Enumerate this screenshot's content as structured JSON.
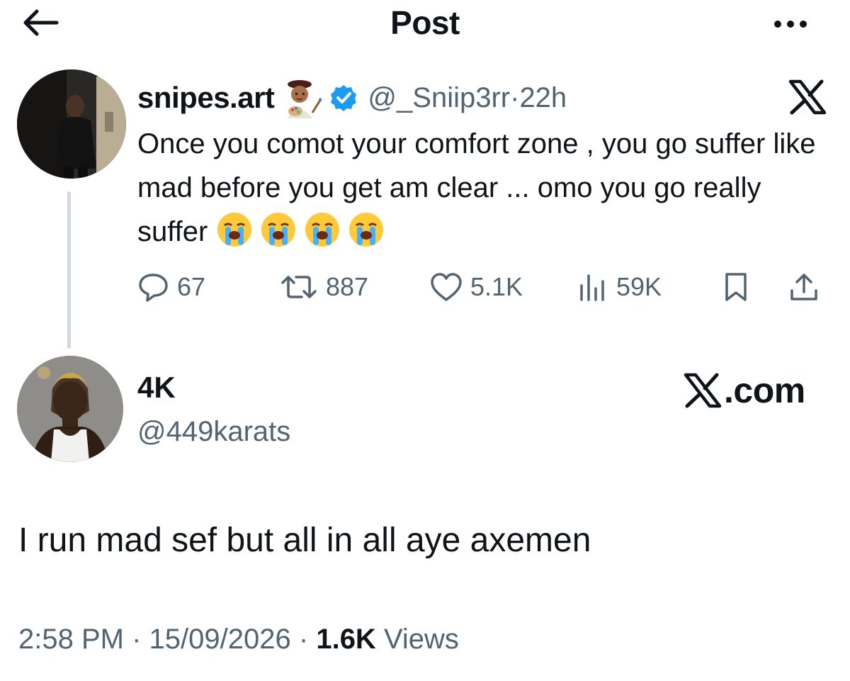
{
  "header": {
    "title": "Post",
    "back_icon": "arrow-left-icon",
    "more_icon": "more-horizontal-icon"
  },
  "quoted_post": {
    "display_name": "snipes.art",
    "name_emoji": "artist-emoji",
    "verified_icon": "verified-badge-icon",
    "handle": "@_Sniip3rr",
    "separator": "·",
    "time": "22h",
    "platform_icon": "x-logo-icon",
    "text": "Once you comot your comfort zone , you go suffer like mad before you get am clear ... omo you go really suffer",
    "text_emojis": [
      "loudly-crying-emoji",
      "loudly-crying-emoji",
      "loudly-crying-emoji",
      "loudly-crying-emoji"
    ],
    "stats": {
      "replies": "67",
      "reposts": "887",
      "likes": "5.1K",
      "views": "59K"
    }
  },
  "post": {
    "display_name": "4K",
    "handle": "@449karats",
    "watermark": ".com",
    "text": "I run mad sef but all in all aye axemen",
    "time": "2:58 PM",
    "sep1": "·",
    "date": "15/09/2026",
    "sep2": "·",
    "view_count": "1.6K",
    "views_label": "Views"
  },
  "colors": {
    "text": "#0f1419",
    "secondary": "#536471",
    "verified": "#1d9bf0",
    "thread_line": "#cfd9de"
  }
}
